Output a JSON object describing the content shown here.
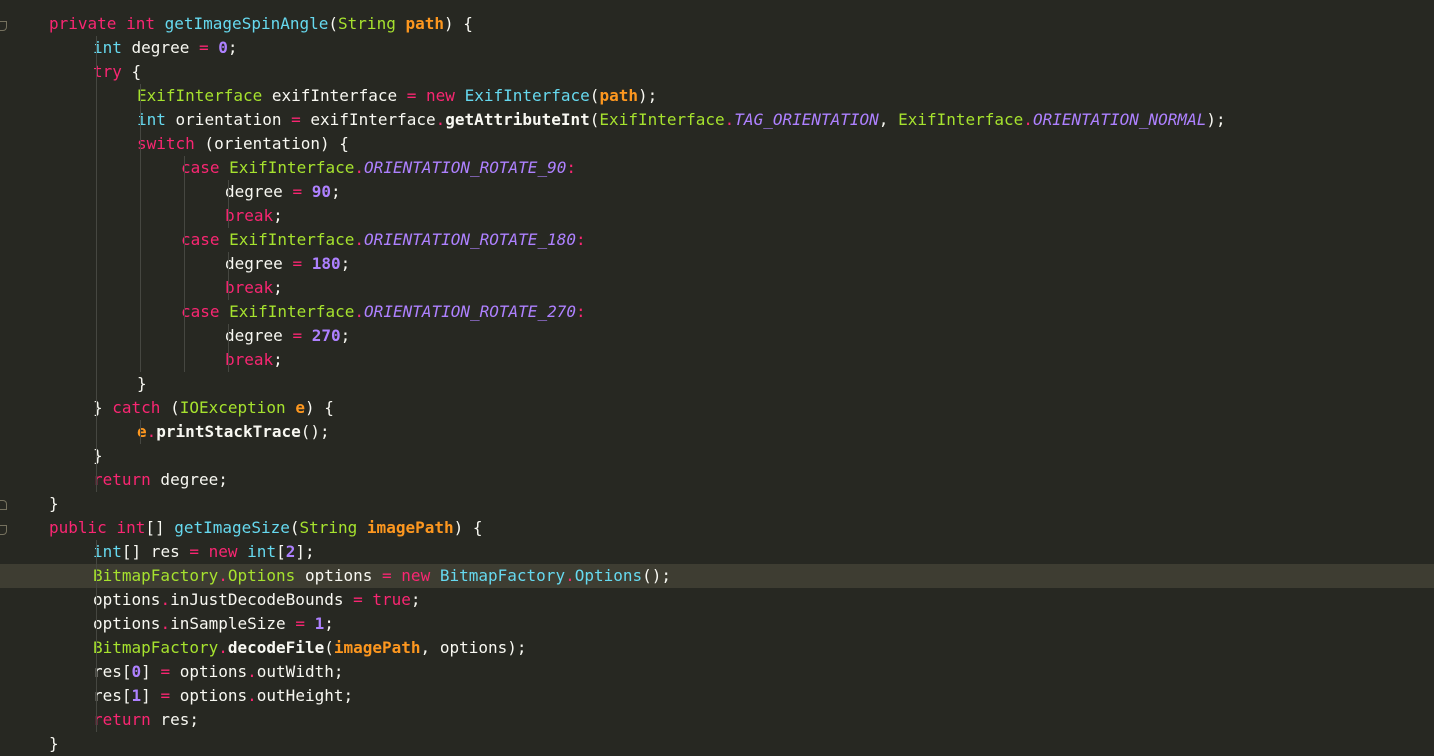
{
  "editor": {
    "theme_colors": {
      "background": "#272822",
      "current_line": "#3E3D32",
      "keyword": "#F92672",
      "type": "#66D9EF",
      "class": "#A6E22E",
      "parameter": "#FD971F",
      "number": "#AE81FF",
      "text": "#F8F8F2"
    },
    "lines": [
      {
        "tokens": [
          [
            "kw",
            "private"
          ],
          [
            "plain",
            " "
          ],
          [
            "kw",
            "int"
          ],
          [
            "plain",
            " "
          ],
          [
            "fn",
            "getImageSpinAngle"
          ],
          [
            "plain",
            "("
          ],
          [
            "cls",
            "String"
          ],
          [
            "plain",
            " "
          ],
          [
            "param",
            "path"
          ],
          [
            "plain",
            ") {"
          ]
        ]
      },
      {
        "tokens": [
          [
            "type",
            "int"
          ],
          [
            "plain",
            " degree "
          ],
          [
            "op",
            "="
          ],
          [
            "plain",
            " "
          ],
          [
            "num",
            "0"
          ],
          [
            "plain",
            ";"
          ]
        ]
      },
      {
        "tokens": [
          [
            "kw",
            "try"
          ],
          [
            "plain",
            " {"
          ]
        ]
      },
      {
        "tokens": [
          [
            "cls",
            "ExifInterface"
          ],
          [
            "plain",
            " exifInterface "
          ],
          [
            "op",
            "="
          ],
          [
            "plain",
            " "
          ],
          [
            "kw",
            "new"
          ],
          [
            "plain",
            " "
          ],
          [
            "type",
            "ExifInterface"
          ],
          [
            "plain",
            "("
          ],
          [
            "param",
            "path"
          ],
          [
            "plain",
            ");"
          ]
        ]
      },
      {
        "tokens": [
          [
            "type",
            "int"
          ],
          [
            "plain",
            " orientation "
          ],
          [
            "op",
            "="
          ],
          [
            "plain",
            " exifInterface"
          ],
          [
            "op",
            "."
          ],
          [
            "call",
            "getAttributeInt"
          ],
          [
            "plain",
            "("
          ],
          [
            "cls",
            "ExifInterface"
          ],
          [
            "op",
            "."
          ],
          [
            "const",
            "TAG_ORIENTATION"
          ],
          [
            "plain",
            ", "
          ],
          [
            "cls",
            "ExifInterface"
          ],
          [
            "op",
            "."
          ],
          [
            "const",
            "ORIENTATION_NORMAL"
          ],
          [
            "plain",
            ");"
          ]
        ]
      },
      {
        "tokens": [
          [
            "kw",
            "switch"
          ],
          [
            "plain",
            " (orientation) {"
          ]
        ]
      },
      {
        "tokens": [
          [
            "kw",
            "case"
          ],
          [
            "plain",
            " "
          ],
          [
            "cls",
            "ExifInterface"
          ],
          [
            "op",
            "."
          ],
          [
            "const",
            "ORIENTATION_ROTATE_90"
          ],
          [
            "op",
            ":"
          ]
        ]
      },
      {
        "tokens": [
          [
            "plain",
            "degree "
          ],
          [
            "op",
            "="
          ],
          [
            "plain",
            " "
          ],
          [
            "num",
            "90"
          ],
          [
            "plain",
            ";"
          ]
        ]
      },
      {
        "tokens": [
          [
            "kw",
            "break"
          ],
          [
            "plain",
            ";"
          ]
        ]
      },
      {
        "tokens": [
          [
            "kw",
            "case"
          ],
          [
            "plain",
            " "
          ],
          [
            "cls",
            "ExifInterface"
          ],
          [
            "op",
            "."
          ],
          [
            "const",
            "ORIENTATION_ROTATE_180"
          ],
          [
            "op",
            ":"
          ]
        ]
      },
      {
        "tokens": [
          [
            "plain",
            "degree "
          ],
          [
            "op",
            "="
          ],
          [
            "plain",
            " "
          ],
          [
            "num",
            "180"
          ],
          [
            "plain",
            ";"
          ]
        ]
      },
      {
        "tokens": [
          [
            "kw",
            "break"
          ],
          [
            "plain",
            ";"
          ]
        ]
      },
      {
        "tokens": [
          [
            "kw",
            "case"
          ],
          [
            "plain",
            " "
          ],
          [
            "cls",
            "ExifInterface"
          ],
          [
            "op",
            "."
          ],
          [
            "const",
            "ORIENTATION_ROTATE_270"
          ],
          [
            "op",
            ":"
          ]
        ]
      },
      {
        "tokens": [
          [
            "plain",
            "degree "
          ],
          [
            "op",
            "="
          ],
          [
            "plain",
            " "
          ],
          [
            "num",
            "270"
          ],
          [
            "plain",
            ";"
          ]
        ]
      },
      {
        "tokens": [
          [
            "kw",
            "break"
          ],
          [
            "plain",
            ";"
          ]
        ]
      },
      {
        "tokens": [
          [
            "plain",
            "}"
          ]
        ]
      },
      {
        "tokens": [
          [
            "plain",
            "} "
          ],
          [
            "kw",
            "catch"
          ],
          [
            "plain",
            " ("
          ],
          [
            "cls",
            "IOException"
          ],
          [
            "plain",
            " "
          ],
          [
            "param",
            "e"
          ],
          [
            "plain",
            ") {"
          ]
        ]
      },
      {
        "tokens": [
          [
            "param",
            "e"
          ],
          [
            "op",
            "."
          ],
          [
            "call",
            "printStackTrace"
          ],
          [
            "plain",
            "();"
          ]
        ]
      },
      {
        "tokens": [
          [
            "plain",
            "}"
          ]
        ]
      },
      {
        "tokens": [
          [
            "kw",
            "return"
          ],
          [
            "plain",
            " degree;"
          ]
        ]
      },
      {
        "tokens": [
          [
            "plain",
            "}"
          ]
        ]
      },
      {
        "tokens": [
          [
            "kw",
            "public"
          ],
          [
            "plain",
            " "
          ],
          [
            "kw",
            "int"
          ],
          [
            "plain",
            "[] "
          ],
          [
            "fn",
            "getImageSize"
          ],
          [
            "plain",
            "("
          ],
          [
            "cls",
            "String"
          ],
          [
            "plain",
            " "
          ],
          [
            "param",
            "imagePath"
          ],
          [
            "plain",
            ") {"
          ]
        ]
      },
      {
        "tokens": [
          [
            "type",
            "int"
          ],
          [
            "plain",
            "[] res "
          ],
          [
            "op",
            "="
          ],
          [
            "plain",
            " "
          ],
          [
            "kw",
            "new"
          ],
          [
            "plain",
            " "
          ],
          [
            "type",
            "int"
          ],
          [
            "plain",
            "["
          ],
          [
            "num",
            "2"
          ],
          [
            "plain",
            "];"
          ]
        ]
      },
      {
        "tokens": [
          [
            "cls",
            "BitmapFactory"
          ],
          [
            "op",
            "."
          ],
          [
            "cls",
            "Options"
          ],
          [
            "plain",
            " options "
          ],
          [
            "op",
            "="
          ],
          [
            "plain",
            " "
          ],
          [
            "kw",
            "new"
          ],
          [
            "plain",
            " "
          ],
          [
            "type",
            "BitmapFactory"
          ],
          [
            "op",
            "."
          ],
          [
            "type",
            "Options"
          ],
          [
            "plain",
            "();"
          ]
        ]
      },
      {
        "tokens": [
          [
            "plain",
            "options"
          ],
          [
            "op",
            "."
          ],
          [
            "fld",
            "inJustDecodeBounds"
          ],
          [
            "plain",
            " "
          ],
          [
            "op",
            "="
          ],
          [
            "plain",
            " "
          ],
          [
            "bool",
            "true"
          ],
          [
            "plain",
            ";"
          ]
        ]
      },
      {
        "tokens": [
          [
            "plain",
            "options"
          ],
          [
            "op",
            "."
          ],
          [
            "fld",
            "inSampleSize"
          ],
          [
            "plain",
            " "
          ],
          [
            "op",
            "="
          ],
          [
            "plain",
            " "
          ],
          [
            "num",
            "1"
          ],
          [
            "plain",
            ";"
          ]
        ]
      },
      {
        "tokens": [
          [
            "cls",
            "BitmapFactory"
          ],
          [
            "op",
            "."
          ],
          [
            "call",
            "decodeFile"
          ],
          [
            "plain",
            "("
          ],
          [
            "param",
            "imagePath"
          ],
          [
            "plain",
            ", options);"
          ]
        ]
      },
      {
        "tokens": [
          [
            "plain",
            "res["
          ],
          [
            "num",
            "0"
          ],
          [
            "plain",
            "] "
          ],
          [
            "op",
            "="
          ],
          [
            "plain",
            " options"
          ],
          [
            "op",
            "."
          ],
          [
            "fld",
            "outWidth"
          ],
          [
            "plain",
            ";"
          ]
        ]
      },
      {
        "tokens": [
          [
            "plain",
            "res["
          ],
          [
            "num",
            "1"
          ],
          [
            "plain",
            "] "
          ],
          [
            "op",
            "="
          ],
          [
            "plain",
            " options"
          ],
          [
            "op",
            "."
          ],
          [
            "fld",
            "outHeight"
          ],
          [
            "plain",
            ";"
          ]
        ]
      },
      {
        "tokens": [
          [
            "kw",
            "return"
          ],
          [
            "plain",
            " res;"
          ]
        ]
      },
      {
        "tokens": [
          [
            "plain",
            "}"
          ]
        ]
      }
    ]
  }
}
